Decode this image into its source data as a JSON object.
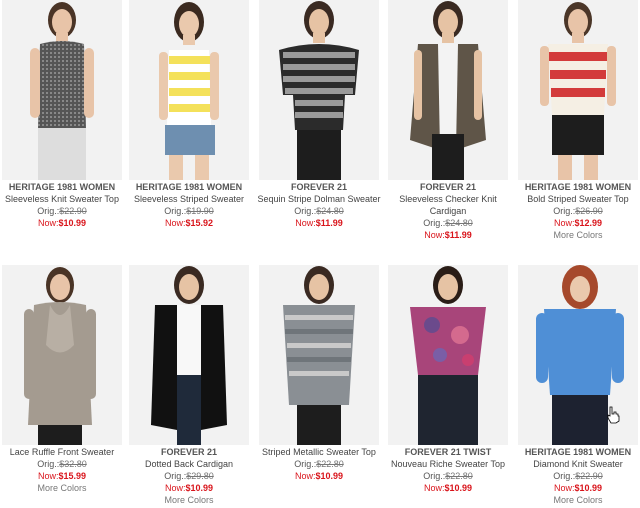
{
  "products": [
    {
      "brand": "HERITAGE 1981 WOMEN",
      "name": "Sleeveless Knit Sweater Top",
      "orig_label": "Orig.:",
      "orig_price": "$22.90",
      "now_label": "Now:",
      "now_price": "$10.99",
      "more": ""
    },
    {
      "brand": "HERITAGE 1981 WOMEN",
      "name": "Sleeveless Striped Sweater",
      "orig_label": "Orig.:",
      "orig_price": "$19.90",
      "now_label": "Now:",
      "now_price": "$15.92",
      "more": ""
    },
    {
      "brand": "FOREVER 21",
      "name": "Sequin Stripe Dolman Sweater",
      "orig_label": "Orig.:",
      "orig_price": "$24.80",
      "now_label": "Now:",
      "now_price": "$11.99",
      "more": ""
    },
    {
      "brand": "FOREVER 21",
      "name": "Sleeveless Checker Knit Cardigan",
      "orig_label": "Orig.:",
      "orig_price": "$24.80",
      "now_label": "Now:",
      "now_price": "$11.99",
      "more": ""
    },
    {
      "brand": "HERITAGE 1981 WOMEN",
      "name": "Bold Striped Sweater Top",
      "orig_label": "Orig.:",
      "orig_price": "$26.90",
      "now_label": "Now:",
      "now_price": "$12.99",
      "more": "More Colors"
    },
    {
      "brand": "",
      "name": "Lace Ruffle Front Sweater",
      "orig_label": "Orig.:",
      "orig_price": "$32.80",
      "now_label": "Now:",
      "now_price": "$15.99",
      "more": "More Colors"
    },
    {
      "brand": "FOREVER 21",
      "name": "Dotted Back Cardigan",
      "orig_label": "Orig.:",
      "orig_price": "$29.80",
      "now_label": "Now:",
      "now_price": "$10.99",
      "more": "More Colors"
    },
    {
      "brand": "",
      "name": "Striped Metallic Sweater Top",
      "orig_label": "Orig.:",
      "orig_price": "$22.80",
      "now_label": "Now:",
      "now_price": "$10.99",
      "more": ""
    },
    {
      "brand": "FOREVER 21 TWIST",
      "name": "Nouveau Riche Sweater Top",
      "orig_label": "Orig.:",
      "orig_price": "$22.80",
      "now_label": "Now:",
      "now_price": "$10.99",
      "more": ""
    },
    {
      "brand": "HERITAGE 1981 WOMEN",
      "name": "Diamond Knit Sweater",
      "orig_label": "Orig.:",
      "orig_price": "$22.90",
      "now_label": "Now:",
      "now_price": "$10.99",
      "more": "More Colors"
    }
  ],
  "colors": {
    "price_now": "#d9141b",
    "background": "#ffffff"
  },
  "icons": [
    "hand-pointer-cursor-icon"
  ]
}
